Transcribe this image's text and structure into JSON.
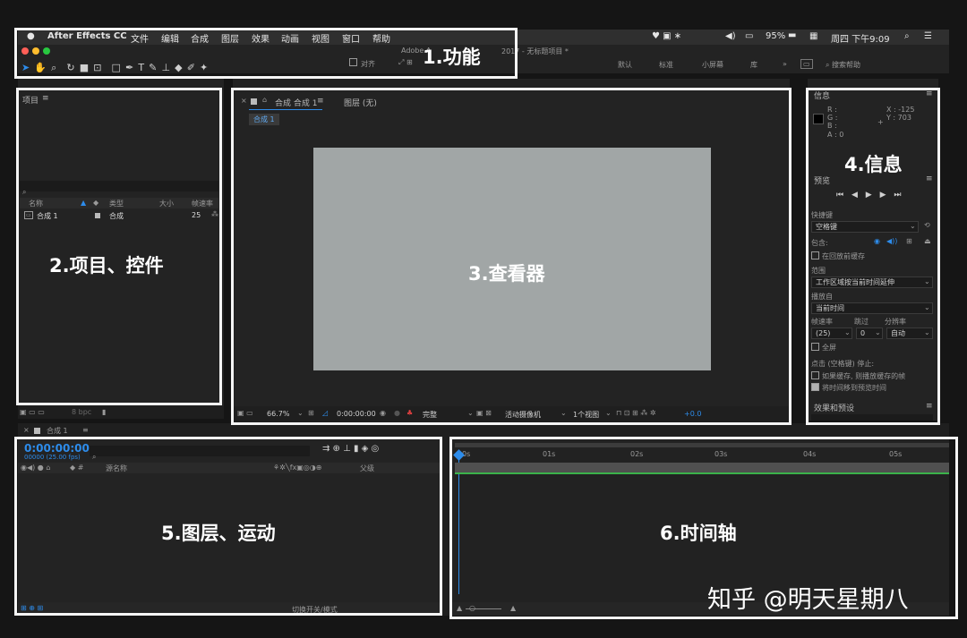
{
  "menubar": {
    "apple": "",
    "app": "After Effects CC",
    "items": [
      "文件",
      "编辑",
      "合成",
      "图层",
      "效果",
      "动画",
      "视图",
      "窗口",
      "帮助"
    ],
    "battery": "95%",
    "datetime": "周四 下午9:09"
  },
  "toolbar": {
    "title": "Adobe A",
    "title2": "2017 - 无标题项目 *",
    "snap": "对齐",
    "workspaces": [
      "默认",
      "标准",
      "小屏幕",
      "库"
    ],
    "search": "搜索帮助"
  },
  "project": {
    "title": "项目",
    "cols": [
      "名称",
      "类型",
      "大小",
      "帧速率"
    ],
    "row": {
      "name": "合成 1",
      "type": "合成",
      "fps": "25"
    },
    "bpc": "8 bpc"
  },
  "viewer": {
    "tab": "合成 合成 1",
    "tab_layer": "图层 (无)",
    "subtab": "合成 1",
    "zoom": "66.7%",
    "time": "0:00:00:00",
    "quality": "完整",
    "camera": "活动摄像机",
    "views": "1个视图",
    "offset": "+0.0"
  },
  "info": {
    "title": "信息",
    "r": "R :",
    "g": "G :",
    "b": "B :",
    "a": "A : 0",
    "x": "X : -125",
    "y": "Y : 703",
    "preview_title": "预览",
    "shortcut_label": "快捷键",
    "shortcut": "空格键",
    "include": "包含:",
    "cache_before": "在回放前缓存",
    "range_label": "范围",
    "range": "工作区域按当前时间延伸",
    "playfrom_label": "播放自",
    "playfrom": "当前时间",
    "fps_label": "帧速率",
    "skip_label": "跳过",
    "res_label": "分辨率",
    "fps": "(25)",
    "skip": "0",
    "res": "自动",
    "fullscreen": "全屏",
    "stop_label": "点击 (空格键) 停止:",
    "opt1": "如果缓存, 则播放缓存的帧",
    "opt2": "将时间移到预览时间",
    "effects_title": "效果和预设"
  },
  "timeline": {
    "tab": "合成 1",
    "time": "0:00:00:00",
    "fps": "00000 (25.00 fps)",
    "source": "源名称",
    "parent": "父级",
    "switch": "切换开关/模式",
    "ticks": [
      "0s",
      "01s",
      "02s",
      "03s",
      "04s",
      "05s"
    ]
  },
  "annotations": {
    "a1": "1.功能",
    "a2": "2.项目、控件",
    "a3": "3.查看器",
    "a4": "4.信息",
    "a5": "5.图层、运动",
    "a6": "6.时间轴"
  },
  "watermark": "知乎 @明天星期八",
  "colors": {
    "accent": "#2d8ceb",
    "comp_bg": "#a1a6a6",
    "timecode": "#2d8ceb"
  }
}
